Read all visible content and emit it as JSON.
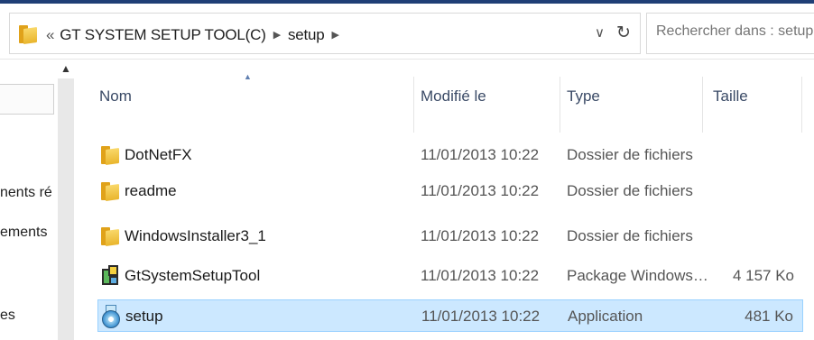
{
  "address_bar": {
    "overflow_chevron": "«",
    "crumbs": [
      "GT SYSTEM SETUP TOOL(C)",
      "setup"
    ],
    "dropdown_icon": "chevron-down-icon",
    "refresh_icon": "refresh-icon"
  },
  "search": {
    "placeholder": "Rechercher dans : setup"
  },
  "nav_pane": {
    "items": [
      "nents ré",
      "ements",
      "es"
    ]
  },
  "columns": {
    "name": "Nom",
    "modified": "Modifié le",
    "type": "Type",
    "size": "Taille"
  },
  "files": [
    {
      "name": "DotNetFX",
      "modified": "11/01/2013 10:22",
      "type": "Dossier de fichiers",
      "size": "",
      "icon": "folder-icon"
    },
    {
      "name": "readme",
      "modified": "11/01/2013 10:22",
      "type": "Dossier de fichiers",
      "size": "",
      "icon": "folder-icon"
    },
    {
      "name": "WindowsInstaller3_1",
      "modified": "11/01/2013 10:22",
      "type": "Dossier de fichiers",
      "size": "",
      "icon": "folder-icon"
    },
    {
      "name": "GtSystemSetupTool",
      "modified": "11/01/2013 10:22",
      "type": "Package Windows…",
      "size": "4 157 Ko",
      "icon": "msi-package-icon"
    },
    {
      "name": "setup",
      "modified": "11/01/2013 10:22",
      "type": "Application",
      "size": "481 Ko",
      "icon": "setup-app-icon",
      "selected": true
    }
  ],
  "colors": {
    "selection_bg": "#cce8ff",
    "selection_border": "#99d1ff",
    "header_text": "#3a4a66",
    "title_bar": "#1f3f76"
  }
}
